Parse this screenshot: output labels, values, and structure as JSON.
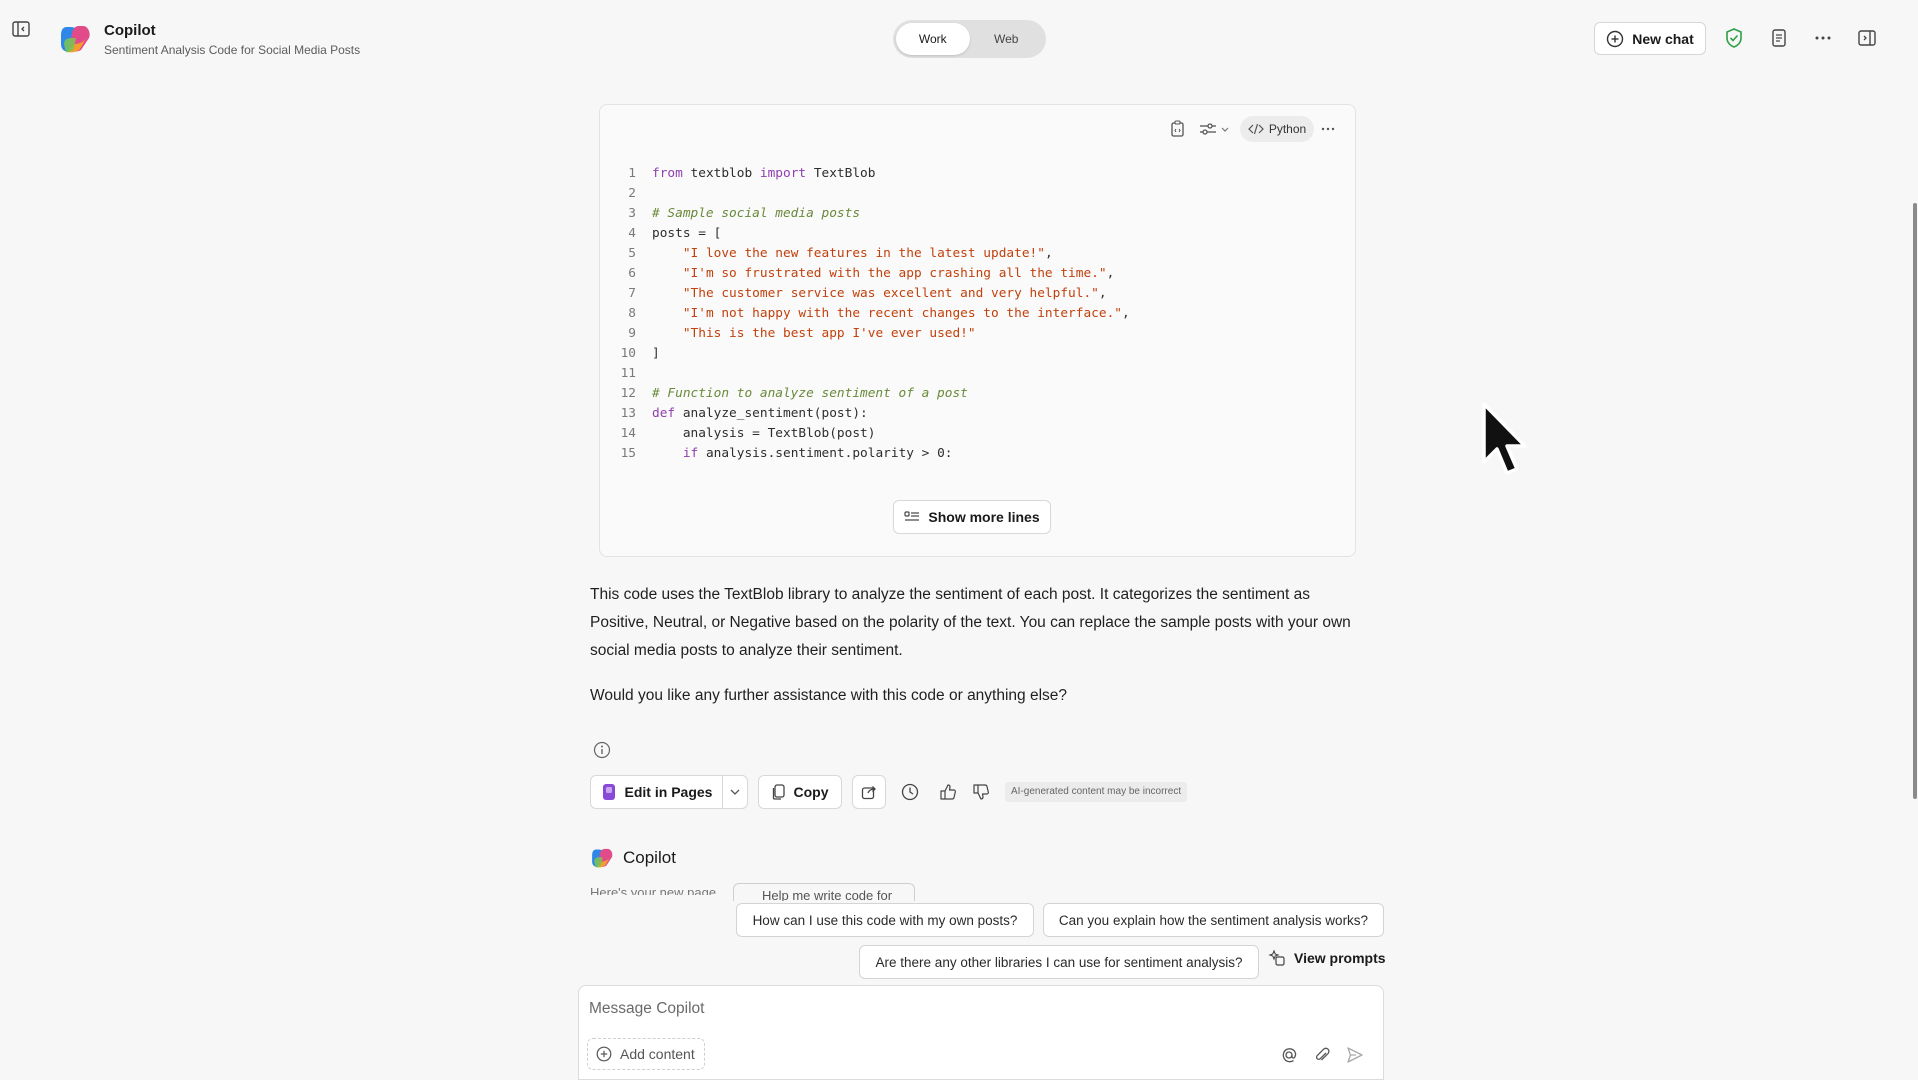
{
  "header": {
    "app_name": "Copilot",
    "chat_title": "Sentiment Analysis Code for Social Media Posts",
    "modes": [
      {
        "label": "Work",
        "active": true
      },
      {
        "label": "Web",
        "active": false
      }
    ],
    "new_chat_label": "New chat",
    "icons": [
      "sidebar-toggle-icon",
      "shield-check-icon",
      "document-icon",
      "more-icon",
      "side-panel-icon"
    ],
    "accent_color": "#2e9e47"
  },
  "code_block": {
    "language": "Python",
    "show_more_label": "Show more lines",
    "lines": [
      {
        "n": "1",
        "parts": [
          {
            "t": "from",
            "c": "k"
          },
          {
            "t": " textblob ",
            "c": "p"
          },
          {
            "t": "import",
            "c": "k"
          },
          {
            "t": " TextBlob",
            "c": "p"
          }
        ]
      },
      {
        "n": "2",
        "parts": []
      },
      {
        "n": "3",
        "parts": [
          {
            "t": "# Sample social media posts",
            "c": "cm"
          }
        ]
      },
      {
        "n": "4",
        "parts": [
          {
            "t": "posts = [",
            "c": "p"
          }
        ]
      },
      {
        "n": "5",
        "parts": [
          {
            "t": "    ",
            "c": "p"
          },
          {
            "t": "\"I love the new features in the latest update!\"",
            "c": "s"
          },
          {
            "t": ",",
            "c": "p"
          }
        ]
      },
      {
        "n": "6",
        "parts": [
          {
            "t": "    ",
            "c": "p"
          },
          {
            "t": "\"I'm so frustrated with the app crashing all the time.\"",
            "c": "s"
          },
          {
            "t": ",",
            "c": "p"
          }
        ]
      },
      {
        "n": "7",
        "parts": [
          {
            "t": "    ",
            "c": "p"
          },
          {
            "t": "\"The customer service was excellent and very helpful.\"",
            "c": "s"
          },
          {
            "t": ",",
            "c": "p"
          }
        ]
      },
      {
        "n": "8",
        "parts": [
          {
            "t": "    ",
            "c": "p"
          },
          {
            "t": "\"I'm not happy with the recent changes to the interface.\"",
            "c": "s"
          },
          {
            "t": ",",
            "c": "p"
          }
        ]
      },
      {
        "n": "9",
        "parts": [
          {
            "t": "    ",
            "c": "p"
          },
          {
            "t": "\"This is the best app I've ever used!\"",
            "c": "s"
          }
        ]
      },
      {
        "n": "10",
        "parts": [
          {
            "t": "]",
            "c": "p"
          }
        ]
      },
      {
        "n": "11",
        "parts": []
      },
      {
        "n": "12",
        "parts": [
          {
            "t": "# Function to analyze sentiment of a post",
            "c": "cm"
          }
        ]
      },
      {
        "n": "13",
        "parts": [
          {
            "t": "def",
            "c": "k"
          },
          {
            "t": " analyze_sentiment(post):",
            "c": "p"
          }
        ]
      },
      {
        "n": "14",
        "parts": [
          {
            "t": "    analysis = TextBlob(post)",
            "c": "p"
          }
        ]
      },
      {
        "n": "15",
        "parts": [
          {
            "t": "    ",
            "c": "p"
          },
          {
            "t": "if",
            "c": "k"
          },
          {
            "t": " analysis.sentiment.polarity > 0:",
            "c": "p"
          }
        ]
      }
    ]
  },
  "response": {
    "paragraphs": [
      "This code uses the TextBlob library to analyze the sentiment of each post. It categorizes the sentiment as Positive, Neutral, or Negative based on the polarity of the text. You can replace the sample posts with your own social media posts to analyze their sentiment.",
      "Would you like any further assistance with this code or anything else?"
    ],
    "actions": {
      "edit_in_pages": "Edit in Pages",
      "copy": "Copy",
      "disclaimer": "AI-generated content may be incorrect"
    }
  },
  "next_message": {
    "author": "Copilot",
    "partial_text": "Here's your new page",
    "partial_chip": "Help me write code for"
  },
  "suggestions": [
    "How can I use this code with my own posts?",
    "Can you explain how the sentiment analysis works?",
    "Are there any other libraries I can use for sentiment analysis?"
  ],
  "view_prompts_label": "View prompts",
  "composer": {
    "placeholder": "Message Copilot",
    "add_content_label": "Add content"
  }
}
